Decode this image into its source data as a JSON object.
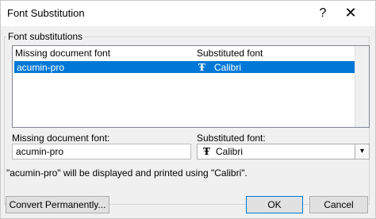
{
  "window": {
    "title": "Font Substitution",
    "help_glyph": "?",
    "close_glyph": "✕"
  },
  "group": {
    "label": "Font substitutions"
  },
  "list": {
    "header_missing": "Missing document font",
    "header_substituted": "Substituted font",
    "rows": [
      {
        "missing": "acumin-pro",
        "substituted": "Calibri",
        "icon": "truetype-font-icon"
      }
    ]
  },
  "fields": {
    "missing_label": "Missing document font:",
    "missing_value": "acumin-pro",
    "substituted_label": "Substituted font:",
    "substituted_value": "Calibri",
    "dropdown_arrow": "▾"
  },
  "message": "\"acumin-pro\" will be displayed and printed using \"Calibri\".",
  "buttons": {
    "convert": "Convert Permanently...",
    "ok": "OK",
    "cancel": "Cancel"
  },
  "icons": {
    "font_glyph": "Ŧ"
  },
  "colors": {
    "selection": "#0078d7",
    "dialog_bg": "#f0f0f0"
  }
}
